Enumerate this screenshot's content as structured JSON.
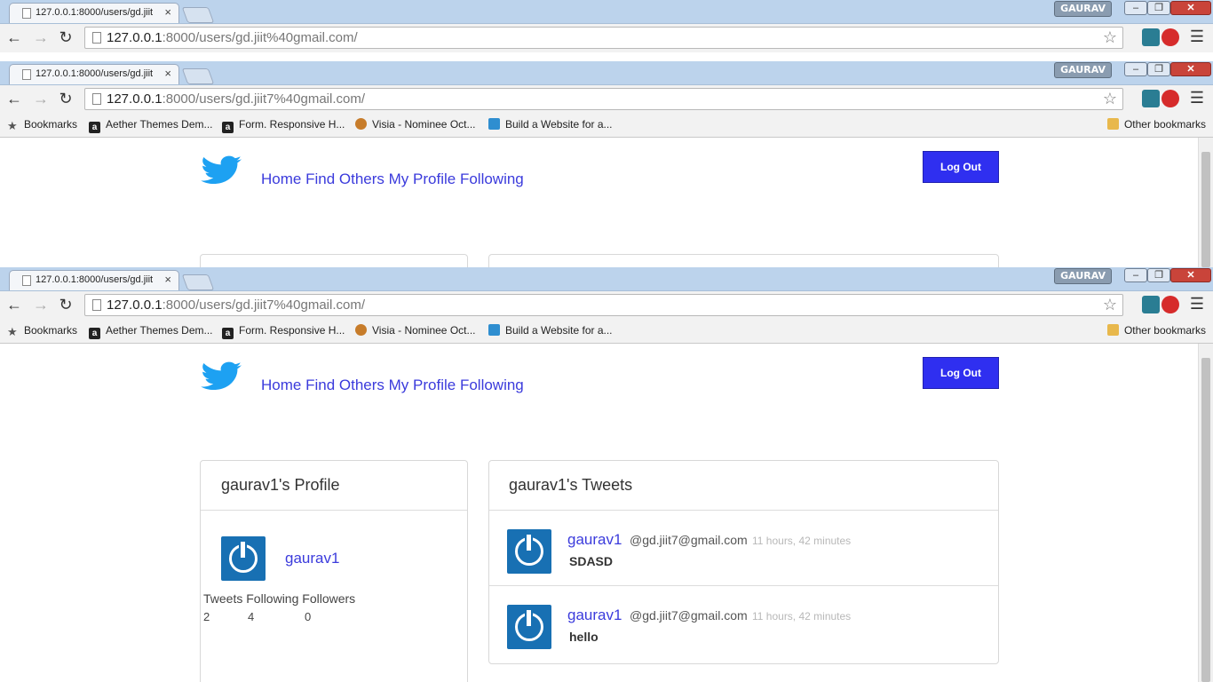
{
  "browser": {
    "tab_title": "127.0.0.1:8000/users/gd.jiit",
    "tab_close": "×",
    "user_badge": "GAURAV",
    "win_min": "–",
    "win_max": "❐",
    "win_close": "✕",
    "url_host": "127.0.0.1",
    "url_rest_1": ":8000/users/gd.jiit%40gmail.com/",
    "url_rest": ":8000/users/gd.jiit7%40gmail.com/",
    "bookmarks": [
      {
        "label": "Bookmarks",
        "icon": "star-icon"
      },
      {
        "label": "Aether Themes Dem...",
        "icon": "a-icon"
      },
      {
        "label": "Form. Responsive H...",
        "icon": "a-icon"
      },
      {
        "label": "Visia - Nominee Oct...",
        "icon": "cog-icon"
      },
      {
        "label": "Build a Website for a...",
        "icon": "bird-icon"
      }
    ],
    "other_bookmarks": "Other bookmarks"
  },
  "nav": {
    "home": "Home",
    "find_others": "Find Others",
    "my_profile": "My Profile",
    "following": "Following",
    "logout": "Log Out"
  },
  "profile": {
    "heading": "gaurav1's Profile",
    "name": "gaurav1",
    "stats_labels": "Tweets Following Followers",
    "tweets": "2",
    "following": "4",
    "followers": "0"
  },
  "tweets": {
    "heading": "gaurav1's Tweets",
    "items": [
      {
        "name": "gaurav1",
        "handle": "@gd.jiit7@gmail.com",
        "time": "11 hours, 42 minutes",
        "text": "SDASD"
      },
      {
        "name": "gaurav1",
        "handle": "@gd.jiit7@gmail.com",
        "time": "11 hours, 42 minutes",
        "text": "hello"
      }
    ]
  },
  "colors": {
    "link": "#3b3bdc",
    "logout_bg": "#2f2ff0",
    "twitter_blue": "#1da1f2",
    "avatar_bg": "#1870b3"
  }
}
